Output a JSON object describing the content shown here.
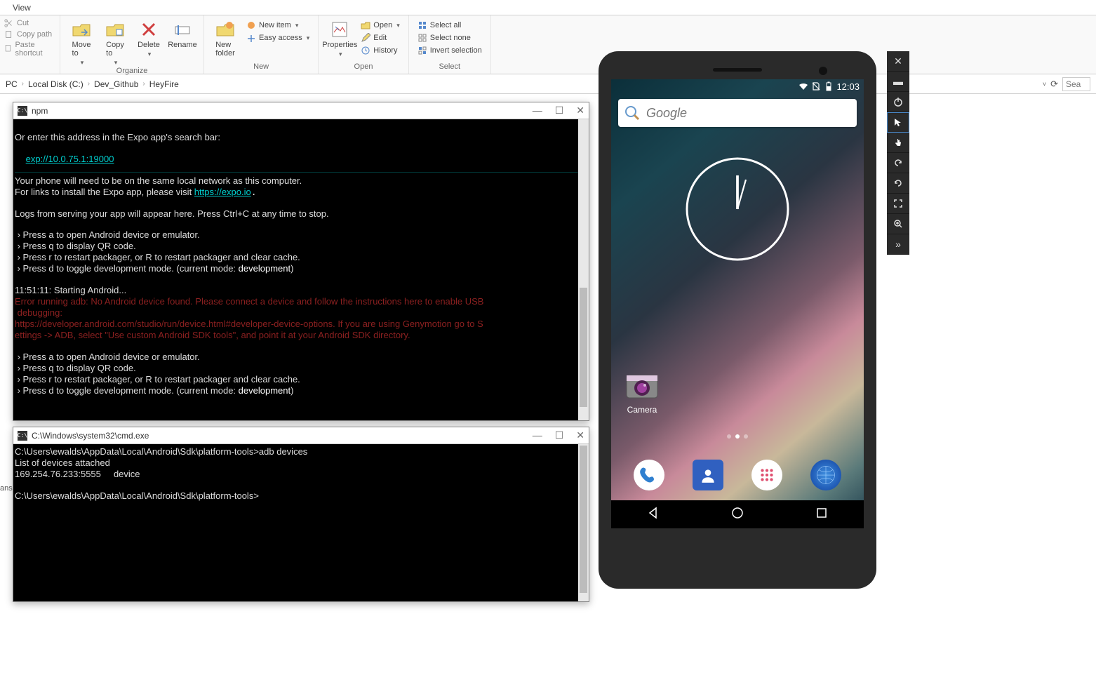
{
  "explorer": {
    "tab": "View",
    "clipboard": {
      "cut": "Cut",
      "copy_path": "Copy path",
      "paste_shortcut": "Paste shortcut"
    },
    "organize": {
      "move_to": "Move\nto",
      "copy_to": "Copy\nto",
      "delete": "Delete",
      "rename": "Rename",
      "label": "Organize"
    },
    "new": {
      "new_folder": "New\nfolder",
      "new_item": "New item",
      "easy_access": "Easy access",
      "label": "New"
    },
    "open": {
      "properties": "Properties",
      "open": "Open",
      "edit": "Edit",
      "history": "History",
      "label": "Open"
    },
    "select": {
      "select_all": "Select all",
      "select_none": "Select none",
      "invert": "Invert selection",
      "label": "Select"
    },
    "breadcrumb": [
      "PC",
      "Local Disk (C:)",
      "Dev_Github",
      "HeyFire"
    ],
    "search_placeholder": "Sea"
  },
  "term1": {
    "title": "npm",
    "lines": {
      "l1": "Or enter this address in the Expo app's search bar:",
      "l2": "exp://10.0.75.1:19000",
      "l3": "Your phone will need to be on the same local network as this computer.",
      "l4a": "For links to install the Expo app, please visit ",
      "l4b": "https://expo.io",
      "l5": "Logs from serving your app will appear here. Press Ctrl+C at any time to stop.",
      "p1": " › Press a to open Android device or emulator.",
      "p2": " › Press q to display QR code.",
      "p3": " › Press r to restart packager, or R to restart packager and clear cache.",
      "p4a": " › Press d to toggle development mode. (current mode: ",
      "p4b": "development",
      "p4c": ")",
      "l6": "11:51:11: Starting Android...",
      "e1": "Error running adb: No Android device found. Please connect a device and follow the instructions here to enable USB",
      "e2": " debugging:",
      "e3": "https://developer.android.com/studio/run/device.html#developer-device-options. If you are using Genymotion go to S",
      "e4": "ettings -> ADB, select \"Use custom Android SDK tools\", and point it at your Android SDK directory."
    }
  },
  "term2": {
    "title": "C:\\Windows\\system32\\cmd.exe",
    "l1": "C:\\Users\\ewalds\\AppData\\Local\\Android\\Sdk\\platform-tools>adb devices",
    "l2": "List of devices attached",
    "l3": "169.254.76.233:5555     device",
    "l4": "C:\\Users\\ewalds\\AppData\\Local\\Android\\Sdk\\platform-tools>"
  },
  "android": {
    "time": "12:03",
    "search_placeholder": "Google",
    "camera_label": "Camera"
  },
  "cut_label": "ans"
}
